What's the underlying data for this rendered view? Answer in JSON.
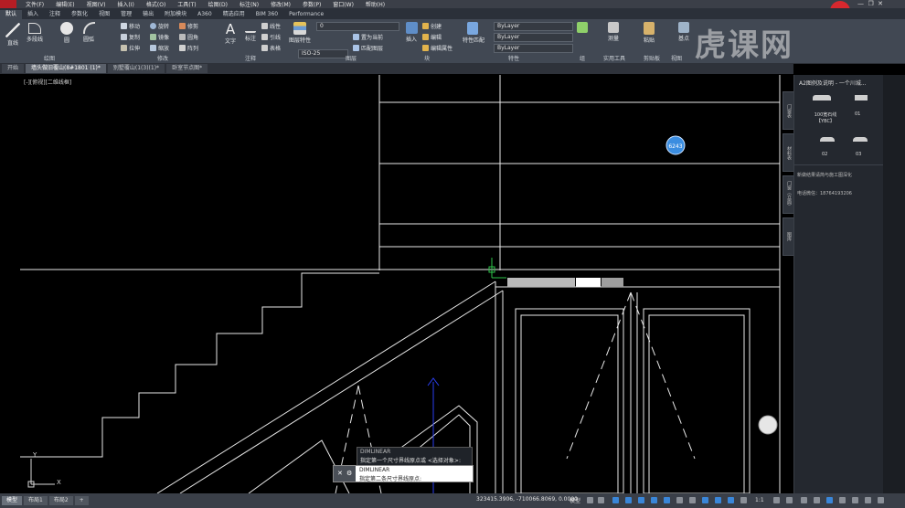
{
  "menu": [
    "文件(F)",
    "编辑(E)",
    "视图(V)",
    "插入(I)",
    "格式(O)",
    "工具(T)",
    "绘图(D)",
    "标注(N)",
    "修改(M)",
    "参数(P)",
    "窗口(W)",
    "帮助(H)"
  ],
  "ribbon_tabs": [
    "默认",
    "插入",
    "注释",
    "参数化",
    "视图",
    "管理",
    "输出",
    "附加模块",
    "A360",
    "精选应用",
    "BIM 360",
    "Performance"
  ],
  "ribbon": {
    "draw": {
      "line": "直线",
      "polyline": "多段线",
      "circle": "圆",
      "arc": "圆弧",
      "title": "绘图"
    },
    "modify": {
      "move": "移动",
      "rotate": "旋转",
      "trim": "修剪",
      "copy": "复制",
      "mirror": "镜像",
      "fillet": "圆角",
      "stretch": "拉伸",
      "scale": "缩放",
      "array": "阵列",
      "title": "修改"
    },
    "annotation": {
      "text": "文字",
      "dimension": "标注",
      "linear": "线性",
      "leader": "引线",
      "table": "表格",
      "title": "注释"
    },
    "layers": {
      "layer_props": "图层特性",
      "layer_value": "0",
      "make_current": "置为当前",
      "match": "匹配图层",
      "title": "图层",
      "style": "ISO-25"
    },
    "block": {
      "insert": "插入",
      "create": "创建",
      "edit": "编辑",
      "edit_attr": "编辑属性",
      "title": "块"
    },
    "properties": {
      "match": "特性匹配",
      "bylayer1": "ByLayer",
      "bylayer2": "ByLayer",
      "bylayer3": "ByLayer",
      "title": "特性"
    },
    "groups": {
      "group": "组",
      "title": "组"
    },
    "utilities": {
      "measure": "测量",
      "title": "实用工具"
    },
    "clipboard": {
      "paste": "粘贴",
      "title": "剪贴板"
    },
    "view": {
      "base": "基点",
      "title": "视图"
    }
  },
  "doc_tabs": [
    "开始",
    "墙头做旧覆山(8#1801 (1)*",
    "别墅覆山(1(3)(1)*",
    "卧室节点图*"
  ],
  "view_label": "[-][俯视][二维线框]",
  "right_panel": {
    "header": "A2图例及说明 - 一个川城...",
    "item1_label": "100宽石线【YBC】",
    "item2_label": "01",
    "item3_label": "02",
    "item4_label": "03",
    "note1": "新做结果请简与施工图深化",
    "note2": "电话微信：18764193206",
    "side_tabs": [
      "门窗表",
      "材料表",
      "门窗（立面）",
      "图库"
    ]
  },
  "command": {
    "history_cmd": "DIMLINEAR",
    "history_prompt": "指定第一个尺寸界线原点或 <选择对象>:",
    "current_cmd": "DIMLINEAR",
    "current_prompt": "指定第二条尺寸界线原点:"
  },
  "status": {
    "layouts": [
      "模型",
      "布局1",
      "布局2"
    ],
    "coords": "323415.3906, -710066.8069, 0.0000",
    "model": "模型",
    "scale": "1:1"
  },
  "watermark": "虎课网",
  "badge": "6243",
  "colors": {
    "accent": "#b51d24",
    "ribbon": "#414853",
    "canvas": "#000000"
  }
}
